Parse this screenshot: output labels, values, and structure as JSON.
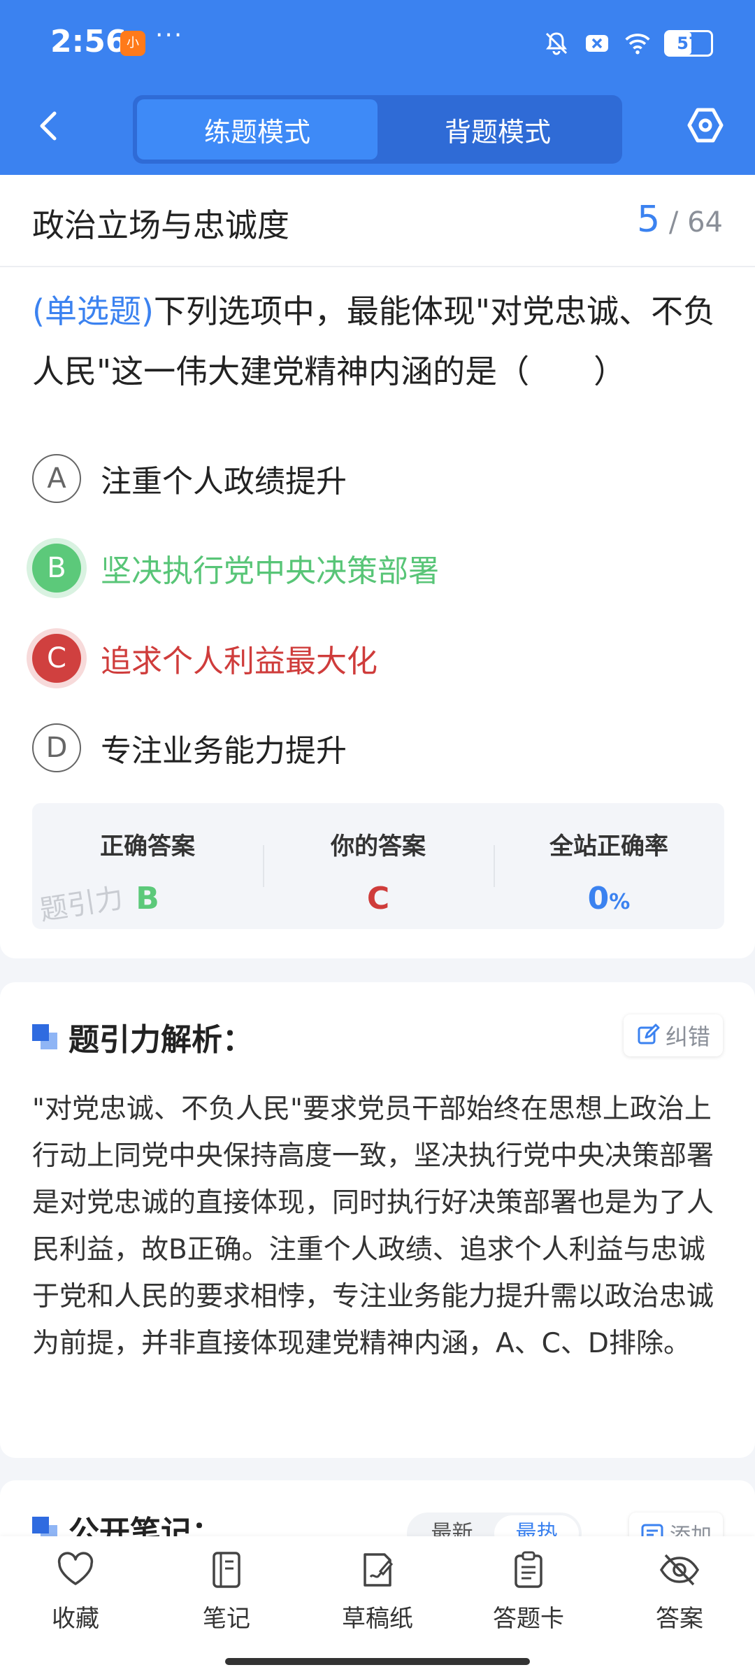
{
  "status_bar": {
    "time": "2:56",
    "app_badge": "小",
    "more": "···",
    "battery": "57"
  },
  "nav": {
    "tabs": [
      {
        "label": "练题模式",
        "active": true
      },
      {
        "label": "背题模式",
        "active": false
      }
    ]
  },
  "question": {
    "title": "政治立场与忠诚度",
    "current": "5",
    "total": "/ 64",
    "type": "(单选题)",
    "text": "下列选项中，最能体现\"对党忠诚、不负人民\"这一伟大建党精神内涵的是（　　）",
    "options": [
      {
        "letter": "A",
        "text": "注重个人政绩提升",
        "state": "normal"
      },
      {
        "letter": "B",
        "text": "坚决执行党中央决策部署",
        "state": "correct"
      },
      {
        "letter": "C",
        "text": "追求个人利益最大化",
        "state": "wrong"
      },
      {
        "letter": "D",
        "text": "专注业务能力提升",
        "state": "normal"
      }
    ]
  },
  "answer": {
    "correct_label": "正确答案",
    "correct_value": "B",
    "yours_label": "你的答案",
    "yours_value": "C",
    "rate_label": "全站正确率",
    "rate_value": "0",
    "rate_unit": "%",
    "watermark": "题引力"
  },
  "analysis": {
    "title": "题引力解析：",
    "correct_button": "纠错",
    "text": "\"对党忠诚、不负人民\"要求党员干部始终在思想上政治上行动上同党中央保持高度一致，坚决执行党中央决策部署是对党忠诚的直接体现，同时执行好决策部署也是为了人民利益，故B正确。注重个人政绩、追求个人利益与忠诚于党和人民的要求相悖，专注业务能力提升需以政治忠诚为前提，并非直接体现建党精神内涵，A、C、D排除。"
  },
  "notes": {
    "title": "公开笔记：",
    "sort_options": [
      {
        "label": "最新",
        "active": false
      },
      {
        "label": "最热",
        "active": true
      }
    ],
    "add_button": "添加"
  },
  "bottom_bar": [
    {
      "label": "收藏",
      "icon": "heart-icon"
    },
    {
      "label": "笔记",
      "icon": "notebook-icon"
    },
    {
      "label": "草稿纸",
      "icon": "scratch-paper-icon"
    },
    {
      "label": "答题卡",
      "icon": "answer-sheet-icon"
    },
    {
      "label": "答案",
      "icon": "eye-off-icon"
    }
  ],
  "colors": {
    "primary": "#3B82F0",
    "correct": "#5CC97A",
    "wrong": "#CF3C3B"
  }
}
